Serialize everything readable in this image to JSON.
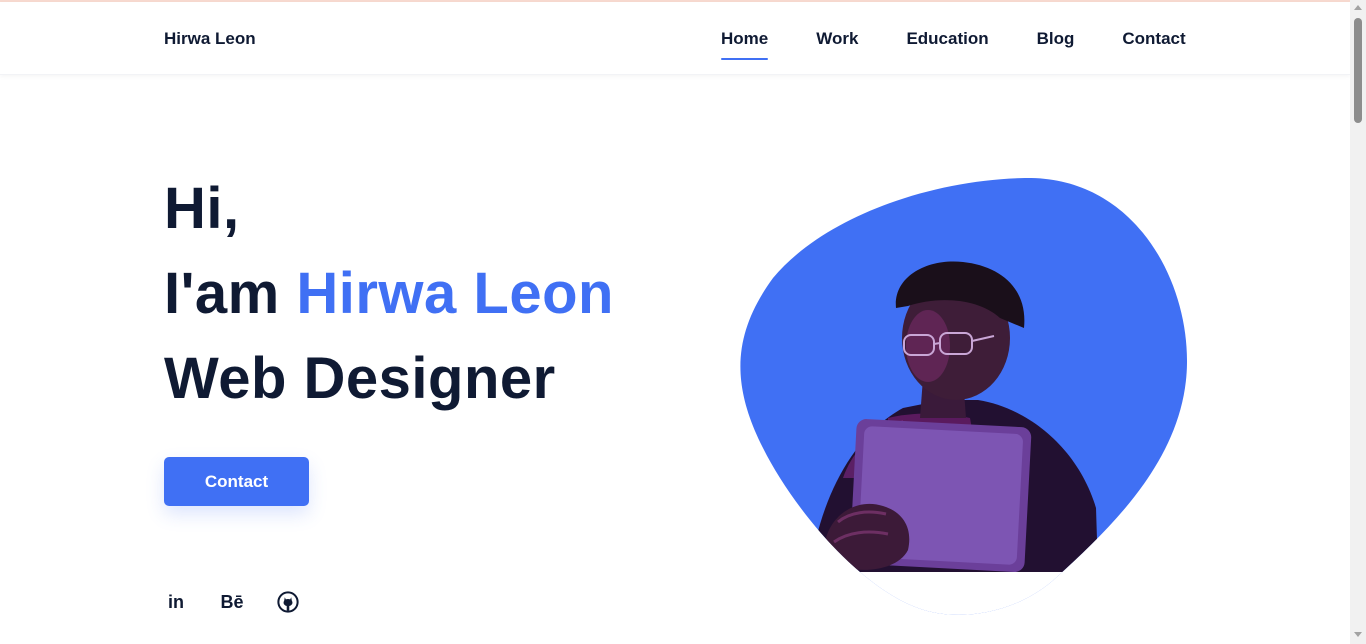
{
  "header": {
    "brand": "Hirwa Leon",
    "nav": [
      {
        "label": "Home",
        "active": true
      },
      {
        "label": "Work",
        "active": false
      },
      {
        "label": "Education",
        "active": false
      },
      {
        "label": "Blog",
        "active": false
      },
      {
        "label": "Contact",
        "active": false
      }
    ]
  },
  "hero": {
    "greeting": "Hi,",
    "intro_prefix": "I'am ",
    "name": "Hirwa Leon",
    "role": "Web Designer",
    "cta_label": "Contact",
    "image_icon": "portrait-photo"
  },
  "socials": [
    {
      "icon": "linkedin-icon",
      "text": "in"
    },
    {
      "icon": "behance-icon",
      "text": "Bē"
    },
    {
      "icon": "github-icon",
      "text": ""
    }
  ],
  "colors": {
    "accent": "#4070f4",
    "text": "#0f1a33",
    "background": "#ffffff"
  }
}
